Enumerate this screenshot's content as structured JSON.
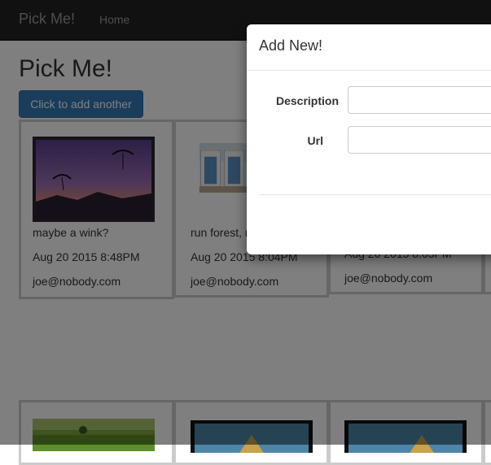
{
  "navbar": {
    "brand": "Pick Me!",
    "home_link": "Home"
  },
  "main": {
    "title": "Pick Me!",
    "add_button_label": "Click to add another",
    "cards": [
      {
        "description": "maybe a wink?",
        "date": "Aug 20 2015 8:48PM",
        "email": "joe@nobody.com"
      },
      {
        "description": "run forest, r",
        "date": "Aug 20 2015 8:04PM",
        "email": "joe@nobody.com"
      },
      {
        "description": "",
        "date": "Aug 20 2015 8:03PM",
        "email": "joe@nobody.com"
      }
    ]
  },
  "modal": {
    "title": "Add New!",
    "description_label": "Description",
    "url_label": "Url",
    "description_value": "",
    "url_value": ""
  },
  "colors": {
    "navbar_bg": "#222222",
    "primary_button": "#337ab7",
    "backdrop": "rgba(0,0,0,0.5)"
  }
}
